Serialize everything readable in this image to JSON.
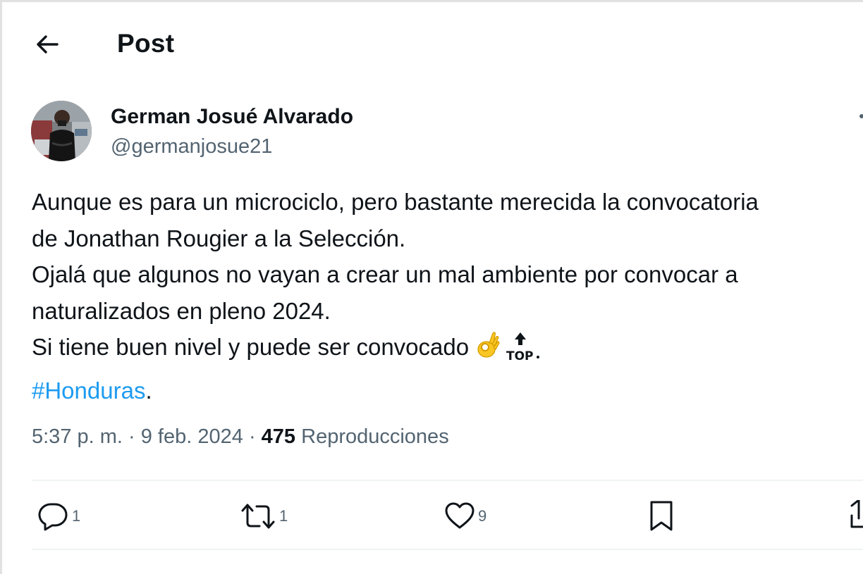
{
  "header": {
    "title": "Post",
    "back_icon": "arrow-left-icon"
  },
  "author": {
    "name": "German Josué Alvarado",
    "handle": "@germanjosue21"
  },
  "post": {
    "lines": [
      "Aunque es para un microciclo, pero bastante merecida la convocatoria",
      "de Jonathan Rougier a la Selección.",
      "Ojalá que algunos no vayan a crear  un mal ambiente por convocar a",
      "naturalizados en pleno 2024.",
      "Si tiene buen nivel y puede ser convocado"
    ],
    "emoji_ok": "ok-hand-emoji",
    "emoji_top": "top-arrow-emoji",
    "emoji_top_text": "TOP",
    "hashtag": "#Honduras",
    "after_hashtag": "."
  },
  "meta": {
    "time": "5:37 p. m.",
    "separator1": " · ",
    "date": "9 feb. 2024",
    "separator2": " · ",
    "views_count": "475",
    "views_label": " Reproducciones"
  },
  "actions": {
    "reply": {
      "icon": "reply-icon",
      "count": "1"
    },
    "repost": {
      "icon": "repost-icon",
      "count": "1"
    },
    "like": {
      "icon": "heart-icon",
      "count": "9"
    },
    "bookmark": {
      "icon": "bookmark-icon"
    },
    "share": {
      "icon": "share-icon"
    }
  },
  "colors": {
    "text": "#0f1419",
    "secondary": "#536471",
    "link": "#1d9bf0",
    "divider": "#eff3f4"
  }
}
